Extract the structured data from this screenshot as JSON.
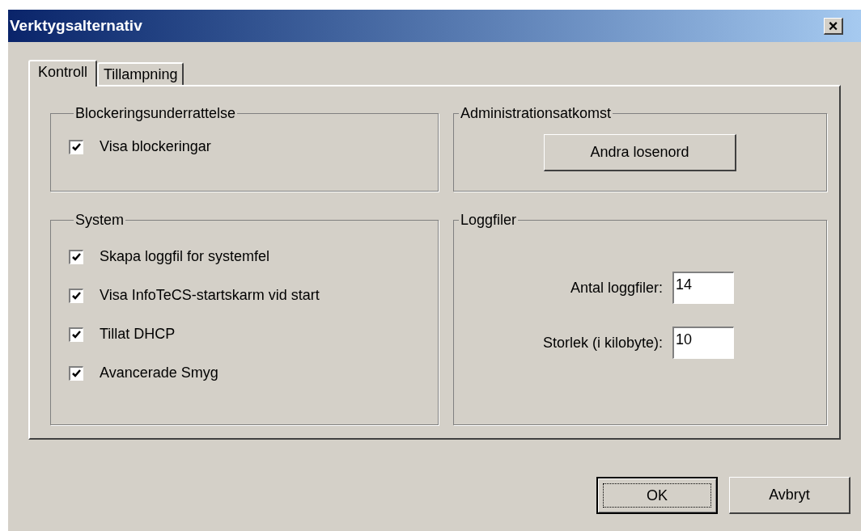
{
  "window": {
    "title": "Verktygsalternativ",
    "close": "×"
  },
  "tabs": [
    {
      "label": "Kontroll",
      "selected": true
    },
    {
      "label": "Tillampning",
      "selected": false
    }
  ],
  "groups": {
    "blocking": {
      "title": "Blockeringsunderrattelse",
      "checkboxes": [
        {
          "label": "Visa blockeringar",
          "checked": true
        }
      ]
    },
    "admin": {
      "title": "Administrationsatkomst",
      "button": "Andra losenord"
    },
    "system": {
      "title": "System",
      "checkboxes": [
        {
          "label": "Skapa loggfil for systemfel",
          "checked": true
        },
        {
          "label": "Visa InfoTeCS-startskarm vid start",
          "checked": true
        },
        {
          "label": "Tillat DHCP",
          "checked": true
        },
        {
          "label": "Avancerade Smyg",
          "checked": true
        }
      ]
    },
    "logs": {
      "title": "Loggfiler",
      "fields": [
        {
          "label": "Antal loggfiler:",
          "value": "14"
        },
        {
          "label": "Storlek (i kilobyte):",
          "value": "10"
        }
      ]
    }
  },
  "buttons": [
    {
      "label": "OK",
      "default": true
    },
    {
      "label": "Avbryt",
      "default": false
    }
  ]
}
